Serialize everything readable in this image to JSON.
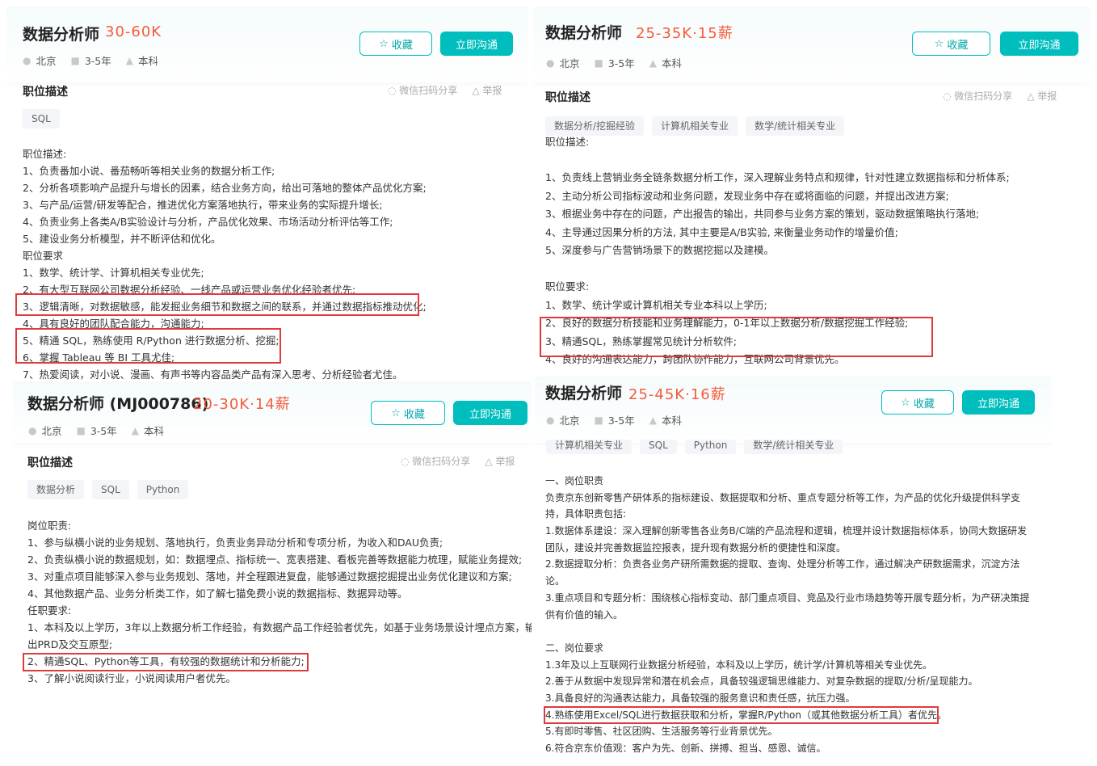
{
  "panels": [
    {
      "title": "数据分析师",
      "salary": "30-60K",
      "meta": [
        "北京",
        "3-5年",
        "本科"
      ],
      "fav": "收藏",
      "chat": "立即沟通",
      "section": "职位描述",
      "share": "微信扫码分享",
      "report": "举报",
      "tags": [
        "SQL"
      ],
      "lines": [
        "职位描述:",
        "1、负责番加小说、番茄畅听等相关业务的数据分析工作;",
        "2、分析各项影响产品提升与增长的因素，结合业务方向，给出可落地的整体产品优化方案;",
        "3、与产品/运营/研发等配合，推进优化方案落地执行，带来业务的实际提升增长;",
        "4、负责业务上各类A/B实验设计与分析，产品优化效果、市场活动分析评估等工作;",
        "5、建设业务分析模型，并不断评估和优化。",
        "职位要求",
        "1、数学、统计学、计算机相关专业优先;",
        "2、有大型互联网公司数据分析经验、一线产品或运营业务优化经验者优先;",
        "3、逻辑清晰，对数据敏感，能发掘业务细节和数据之间的联系，并通过数据指标推动优化;",
        "4、具有良好的团队配合能力，沟通能力;",
        "5、精通 SQL，熟练使用 R/Python 进行数据分析、挖掘;",
        "6、掌握 Tableau 等 BI 工具尤佳;",
        "7、热爱阅读，对小说、漫画、有声书等内容品类产品有深入思考、分析经验者尤佳。"
      ]
    },
    {
      "title": "数据分析师",
      "salary": "25-35K·15薪",
      "meta": [
        "北京",
        "3-5年",
        "本科"
      ],
      "fav": "收藏",
      "chat": "立即沟通",
      "section": "职位描述",
      "share": "微信扫码分享",
      "report": "举报",
      "tags": [
        "数据分析/挖掘经验",
        "计算机相关专业",
        "数学/统计相关专业"
      ],
      "lines": [
        "职位描述:",
        "1、负责线上营销业务全链条数据分析工作，深入理解业务特点和规律，针对性建立数据指标和分析体系;",
        "2、主动分析公司指标波动和业务问题，发现业务中存在或将面临的问题，并提出改进方案;",
        "3、根据业务中存在的问题，产出报告的输出，共同参与业务方案的策划，驱动数据策略执行落地;",
        "4、主导通过因果分析的方法, 其中主要是A/B实验, 来衡量业务动作的增量价值;",
        "5、深度参与广告营销场景下的数据挖掘以及建模。",
        "",
        "职位要求:",
        "1、数学、统计学或计算机相关专业本科以上学历;",
        "2、良好的数据分析技能和业务理解能力，0-1年以上数据分析/数据挖掘工作经验;",
        "3、精通SQL，熟练掌握常见统计分析软件;",
        "4、良好的沟通表达能力，跨团队协作能力，互联网公司背景优先。"
      ]
    },
    {
      "title": "数据分析师 (MJ000786)",
      "salary": "20-30K·14薪",
      "meta": [
        "北京",
        "3-5年",
        "本科"
      ],
      "fav": "收藏",
      "chat": "立即沟通",
      "section": "职位描述",
      "share": "微信扫码分享",
      "report": "举报",
      "tags": [
        "数据分析",
        "SQL",
        "Python"
      ],
      "lines": [
        "岗位职责:",
        "1、参与纵横小说的业务规划、落地执行，负责业务异动分析和专项分析，为收入和DAU负责;",
        "2、负责纵横小说的数据规划，如：数据埋点、指标统一、宽表搭建、看板完善等数据能力梳理，赋能业务提效;",
        "3、对重点项目能够深入参与业务规划、落地，并全程跟进复盘，能够通过数据挖掘提出业务优化建议和方案;",
        "4、其他数据产品、业务分析类工作，如了解七猫免费小说的数据指标、数据异动等。",
        "任职要求:",
        "1、本科及以上学历，3年以上数据分析工作经验，有数据产品工作经验者优先，如基于业务场景设计埋点方案，输",
        "出PRD及交互原型;",
        "2、精通SQL、Python等工具，有较强的数据统计和分析能力;",
        "3、了解小说阅读行业，小说阅读用户者优先。"
      ]
    },
    {
      "title": "数据分析师",
      "salary": "25-45K·16薪",
      "meta": [
        "北京",
        "3-5年",
        "本科"
      ],
      "fav": "收藏",
      "chat": "立即沟通",
      "tags": [
        "计算机相关专业",
        "SQL",
        "Python",
        "数学/统计相关专业"
      ],
      "lines": [
        "一、岗位职责",
        "负责京东创新零售产研体系的指标建设、数据提取和分析、重点专题分析等工作，为产品的优化升级提供科学支",
        "持，具体职责包括:",
        "1.数据体系建设：深入理解创新零售各业务B/C端的产品流程和逻辑，梳理并设计数据指标体系，协同大数据研发",
        "团队，建设并完善数据监控报表，提升现有数据分析的便捷性和深度。",
        "2.数据提取分析：负责各业务产研所需数据的提取、查询、处理分析等工作，通过解决产研数据需求，沉淀方法",
        "论。",
        "3.重点项目和专题分析：围绕核心指标变动、部门重点项目、竞品及行业市场趋势等开展专题分析，为产研决策提",
        "供有价值的输入。",
        "",
        "二、岗位要求",
        "1.3年及以上互联网行业数据分析经验，本科及以上学历，统计学/计算机等相关专业优先。",
        "2.善于从数据中发现异常和潜在机会点，具备较强逻辑思维能力、对复杂数据的提取/分析/呈现能力。",
        "3.具备良好的沟通表达能力，具备较强的服务意识和责任感，抗压力强。",
        "4.熟练使用Excel/SQL进行数据获取和分析，掌握R/Python（或其他数据分析工具）者优先。",
        "5.有即时零售、社区团购、生活服务等行业背景优先。",
        "6.符合京东价值观：客户为先、创新、拼搏、担当、感恩、诚信。"
      ]
    }
  ]
}
